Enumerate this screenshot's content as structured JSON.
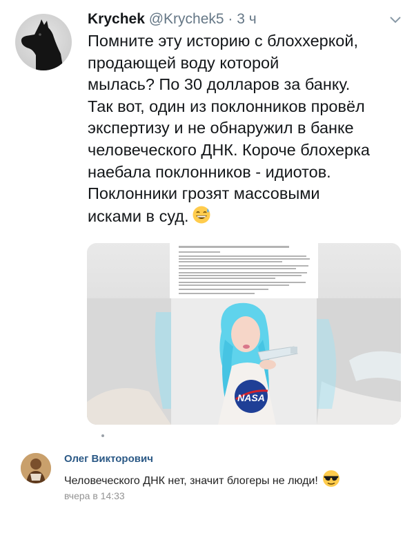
{
  "tweet": {
    "author_name": "Krychek",
    "author_handle": "@Krychek5",
    "separator": " · ",
    "time": "3 ч",
    "lines": [
      "Помните эту историю с блоххеркой,",
      "продающей  воду которой",
      "мылась? По 30 долларов за банку.",
      "Так вот, один из поклонников провёл",
      "экспертизу и не обнаружил в банке",
      "человеческого  ДНК. Короче блохерка",
      "наебала поклонников - идиотов.",
      "Поклонники грозят массовыми",
      "исками в суд."
    ],
    "end_emoji": "grinning-sweat-emoji",
    "media_shirt_text": "NASA",
    "colors": {
      "hair": "#5fd3ec",
      "shirt": "#f4f1ee",
      "nasa_blue": "#1f3f96",
      "nasa_red": "#d5232b"
    }
  },
  "comment": {
    "author_name": "Олег Викторович",
    "text": "Человеческого ДНК нет, значит блогеры не люди!",
    "emoji": "sunglasses-emoji",
    "time": "вчера в 14:33",
    "link_color": "#2a5885"
  }
}
